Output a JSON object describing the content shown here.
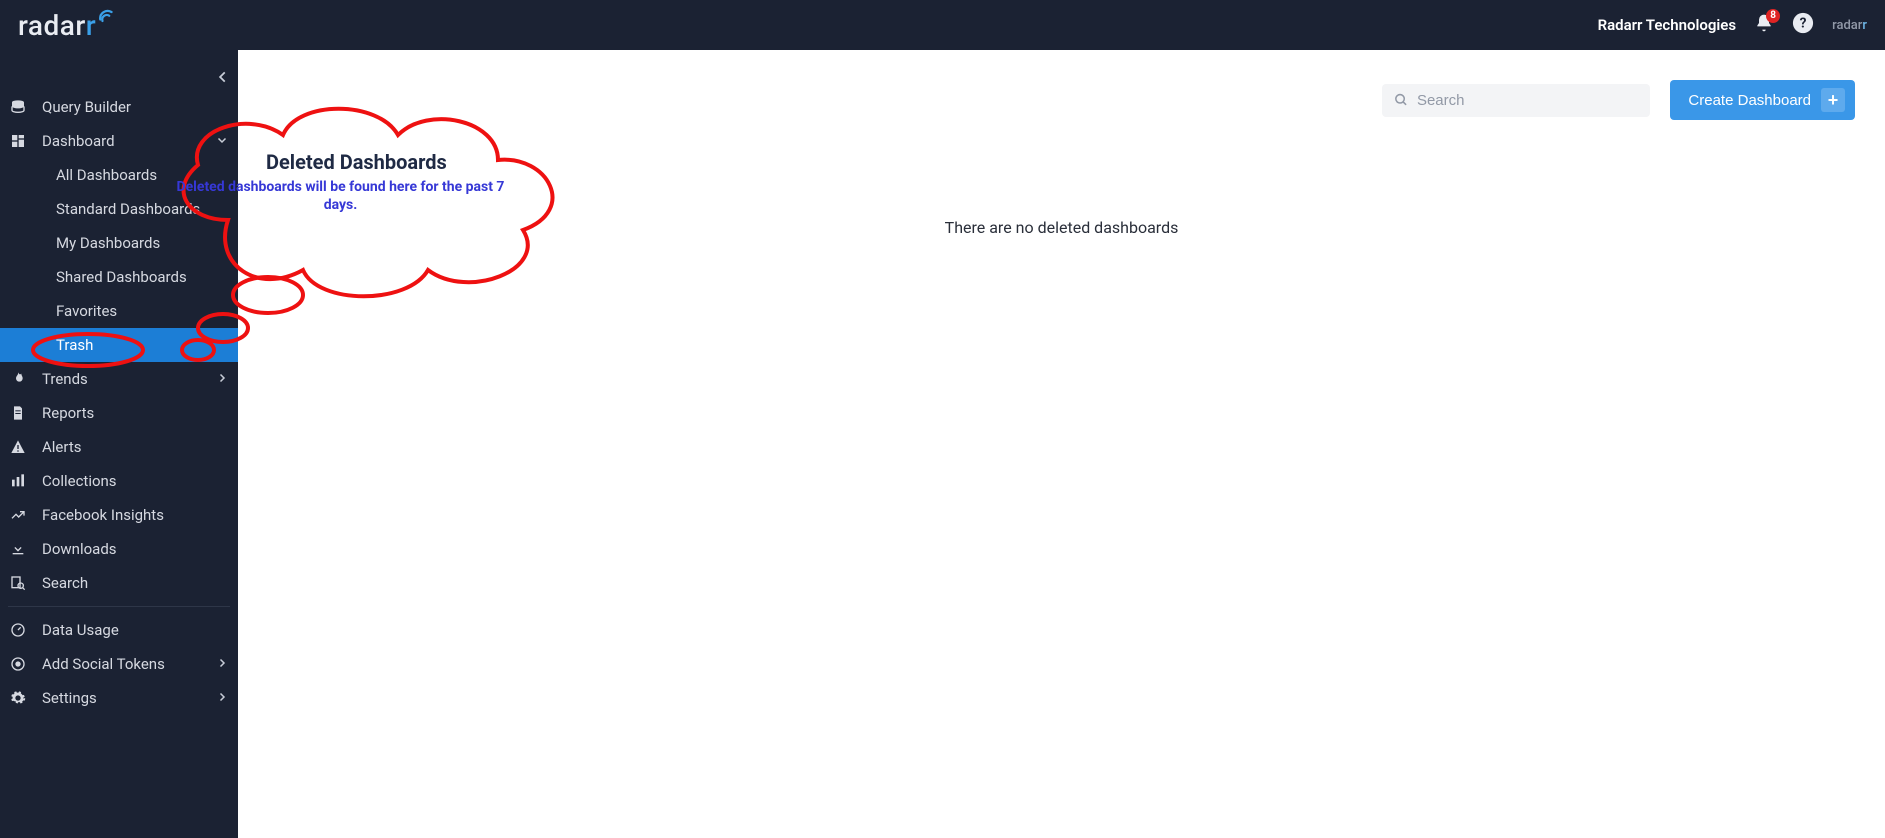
{
  "header": {
    "brand_main": "radar",
    "brand_accent": "r",
    "org_name": "Radarr Technologies",
    "notif_count": "8"
  },
  "sidebar": {
    "query_builder": "Query Builder",
    "dashboard": "Dashboard",
    "sub": {
      "all": "All Dashboards",
      "standard": "Standard Dashboards",
      "my": "My Dashboards",
      "shared": "Shared Dashboards",
      "favorites": "Favorites",
      "trash": "Trash"
    },
    "trends": "Trends",
    "reports": "Reports",
    "alerts": "Alerts",
    "collections": "Collections",
    "fb_insights": "Facebook Insights",
    "downloads": "Downloads",
    "search": "Search",
    "data_usage": "Data Usage",
    "add_tokens": "Add Social Tokens",
    "settings": "Settings"
  },
  "main": {
    "search_placeholder": "Search",
    "create_label": "Create Dashboard",
    "page_title": "Deleted Dashboards",
    "empty_msg": "There are no deleted dashboards"
  },
  "annotation": {
    "text": "Deleted dashboards will be found here for the past 7 days."
  }
}
